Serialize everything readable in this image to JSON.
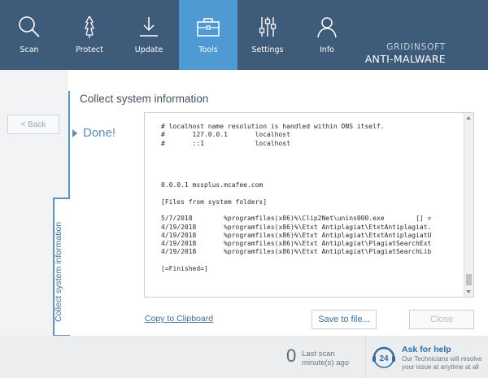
{
  "nav": {
    "items": [
      {
        "label": "Scan",
        "icon": "search-icon"
      },
      {
        "label": "Protect",
        "icon": "shield-hand-icon"
      },
      {
        "label": "Update",
        "icon": "download-icon"
      },
      {
        "label": "Tools",
        "icon": "toolbox-icon",
        "active": true
      },
      {
        "label": "Settings",
        "icon": "sliders-icon"
      },
      {
        "label": "Info",
        "icon": "user-icon"
      }
    ],
    "brand_line1": "GRIDINSOFT",
    "brand_line2": "ANTI-MALWARE"
  },
  "side": {
    "back_label": "< Back",
    "vertical_tab_label": "Collect system information"
  },
  "main": {
    "title": "Collect system information",
    "status": "Done!",
    "log_lines": [
      "# localhost name resolution is handled within DNS itself.",
      "#       127.0.0.1       localhost",
      "#       ::1             localhost",
      "",
      "",
      "",
      "",
      "0.0.0.1 mssplus.mcafee.com",
      "",
      "[Files from system folders]",
      "",
      "5/7/2018        %programfiles(x86)%\\Clip2Net\\unins000.exe        [] =",
      "4/19/2018       %programfiles(x86)%\\Etxt Antiplagiat\\EtxtAntiplagiat.",
      "4/19/2018       %programfiles(x86)%\\Etxt Antiplagiat\\EtxtAntiplagiatU",
      "4/19/2018       %programfiles(x86)%\\Etxt Antiplagiat\\PlagiatSearchExt",
      "4/19/2018       %programfiles(x86)%\\Etxt Antiplagiat\\PlagiatSearchLib",
      "",
      "[=Finished=]"
    ],
    "copy_link": "Copy to Clipboard",
    "save_button": "Save to file...",
    "close_button": "Close"
  },
  "bottom": {
    "last_scan_value": "0",
    "last_scan_line1": "Last scan",
    "last_scan_line2": "minute(s) ago",
    "help_title": "Ask for help",
    "help_sub": "Our Technicians will resolve your issue at anytime at all",
    "help_icon_text": "24"
  },
  "colors": {
    "topbar": "#3f5b7a",
    "active_tab": "#4f9ad3",
    "accent": "#5a8dbf"
  }
}
